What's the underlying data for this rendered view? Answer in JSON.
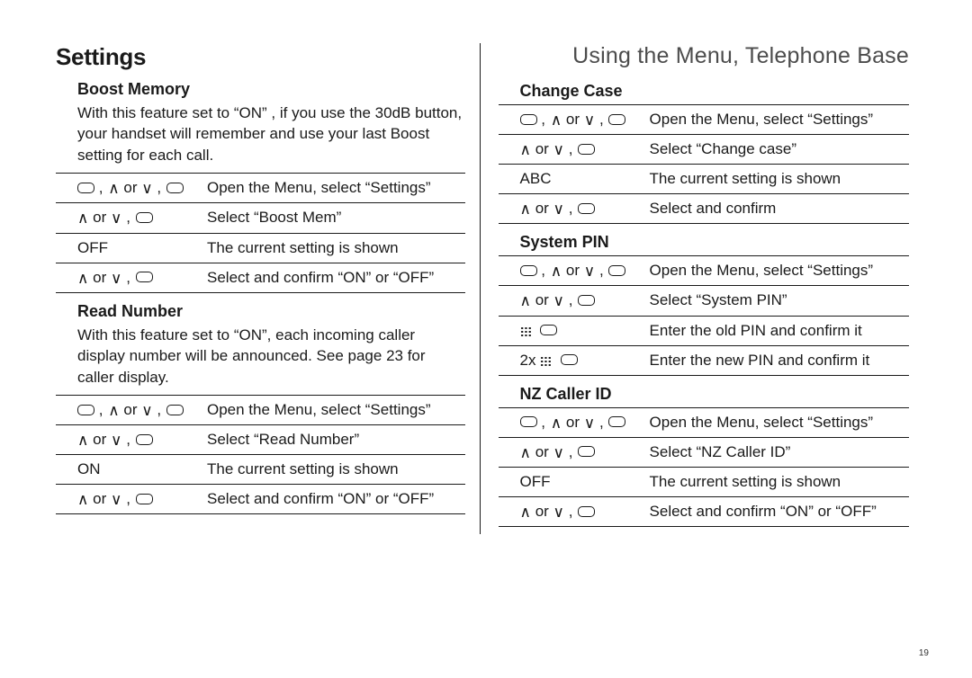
{
  "breadcrumb": "Using the Menu, Telephone Base",
  "pageNumber": "19",
  "heading": "Settings",
  "left": {
    "boostMemory": {
      "title": "Boost Memory",
      "intro": "With this feature set to “ON” , if you use the 30dB button, your handset will remember and use your last Boost setting for each call.",
      "rows": [
        {
          "keyType": "softNavSoft",
          "desc": "Open the Menu, select “Settings”"
        },
        {
          "keyType": "navSoft",
          "desc": "Select “Boost Mem”"
        },
        {
          "keyText": "OFF",
          "desc": "The current setting is shown"
        },
        {
          "keyType": "navSoft",
          "desc": "Select and confirm “ON” or “OFF”"
        }
      ]
    },
    "readNumber": {
      "title": "Read Number",
      "intro": "With this feature set to “ON”, each incoming caller display number will be announced. See page 23 for caller display.",
      "rows": [
        {
          "keyType": "softNavSoft",
          "desc": "Open the Menu, select “Settings”"
        },
        {
          "keyType": "navSoft",
          "desc": "Select “Read Number”"
        },
        {
          "keyText": "ON",
          "desc": "The current setting is shown"
        },
        {
          "keyType": "navSoft",
          "desc": "Select and confirm “ON” or “OFF”"
        }
      ]
    }
  },
  "right": {
    "changeCase": {
      "title": "Change Case",
      "rows": [
        {
          "keyType": "softNavSoft",
          "desc": "Open the Menu, select “Settings”"
        },
        {
          "keyType": "navSoft",
          "desc": "Select “Change case”"
        },
        {
          "keyText": "ABC",
          "desc": "The current setting is shown"
        },
        {
          "keyType": "navSoft",
          "desc": "Select and confirm"
        }
      ]
    },
    "systemPin": {
      "title": "System PIN",
      "rows": [
        {
          "keyType": "softNavSoft",
          "desc": "Open the Menu, select “Settings”"
        },
        {
          "keyType": "navSoft",
          "desc": "Select “System PIN”"
        },
        {
          "keyType": "dialSoft",
          "desc": "Enter the old PIN and confirm it"
        },
        {
          "keyType": "twoXDialSoft",
          "keyPrefix": "2x ",
          "desc": "Enter the new PIN and confirm it"
        }
      ]
    },
    "nzCallerId": {
      "title": "NZ Caller ID",
      "rows": [
        {
          "keyType": "softNavSoft",
          "desc": "Open the Menu, select “Settings”"
        },
        {
          "keyType": "navSoft",
          "desc": "Select “NZ Caller ID”"
        },
        {
          "keyText": "OFF",
          "desc": "The current setting is shown"
        },
        {
          "keyType": "navSoft",
          "desc": "Select and confirm “ON” or “OFF”"
        }
      ]
    }
  }
}
